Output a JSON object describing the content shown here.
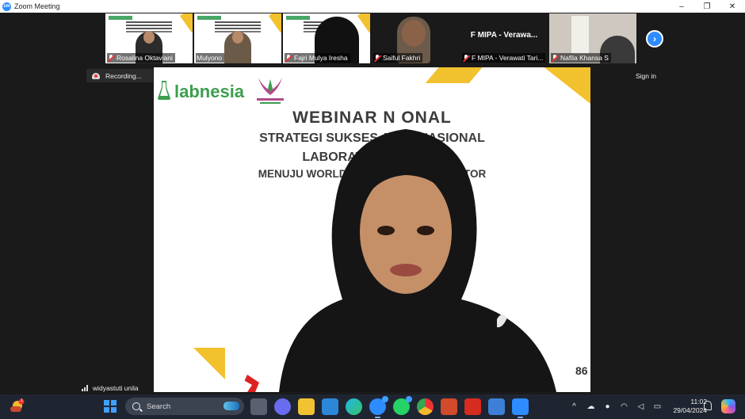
{
  "window": {
    "app_icon_text": "zm",
    "title": "Zoom Meeting",
    "minimize_glyph": "–",
    "maximize_glyph": "❐",
    "close_glyph": "✕"
  },
  "participants": [
    {
      "name": "Rosalina Oktaviani",
      "muted": true
    },
    {
      "name": "Mulyono",
      "muted": false
    },
    {
      "name": "Fajri Mulya Iresha",
      "muted": true
    },
    {
      "name": "Saiful Fakhri",
      "muted": true
    },
    {
      "name": "F MIPA - Verawati Tari...",
      "display_name": "F MIPA - Verawa...",
      "muted": true
    },
    {
      "name": "Nafila Khansa S",
      "muted": true
    }
  ],
  "next_page_glyph": "›",
  "recording_label": "Recording...",
  "signin_label": "Sign in",
  "slide": {
    "logo_text": "labnesia",
    "emblem_text": "PADMA GLOBAL NUSANTARA",
    "line1": "WEBINAR N      ONAL",
    "line2": "STRATEGI SUKSES A               TERNASIONAL",
    "line3": "LABORATORIU                  TINGGI",
    "line4": "MENUJU WORLD CLASS U                   ME GENERATOR",
    "line5": "(",
    "page_number": "86"
  },
  "active_speaker_name": "widyastuti unila",
  "taskbar": {
    "search_placeholder": "Search",
    "notification_badge": "1",
    "time": "11:02",
    "date": "29/04/2024",
    "tray_chevron": "^"
  },
  "colors": {
    "zoom_blue": "#2d8cff",
    "slide_yellow": "#f2c12e",
    "labnesia_green": "#3c9e4f"
  }
}
